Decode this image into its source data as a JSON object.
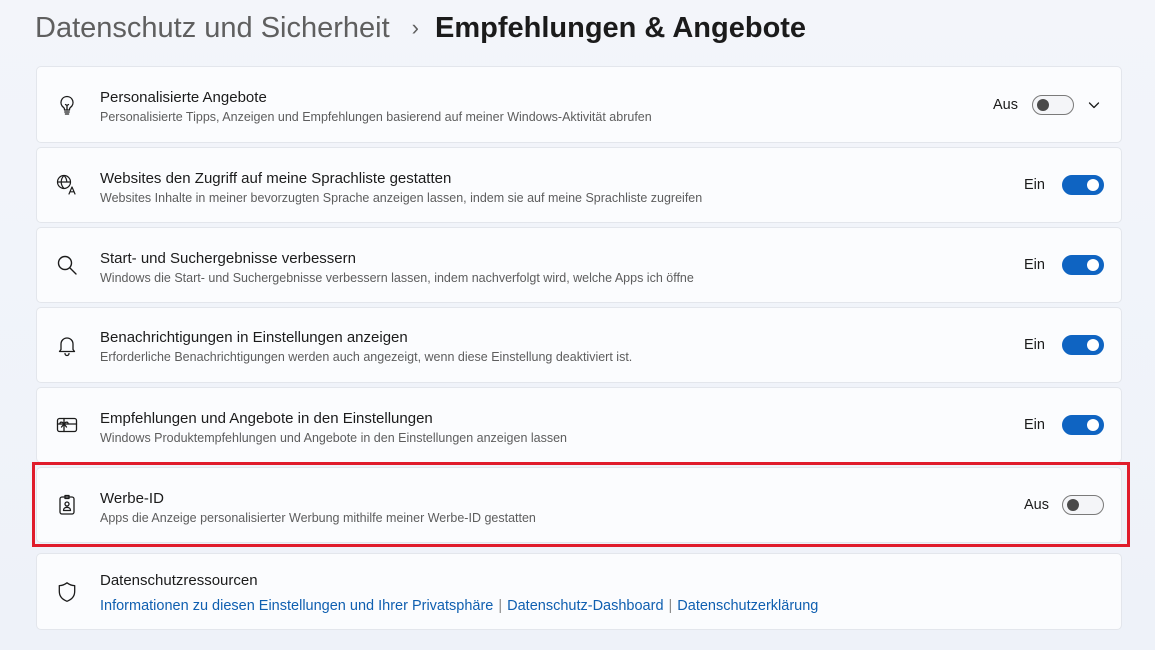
{
  "breadcrumb": {
    "parent": "Datenschutz und Sicherheit",
    "separator": "›",
    "current": "Empfehlungen & Angebote"
  },
  "settings": [
    {
      "title": "Personalisierte Angebote",
      "subtitle": "Personalisierte Tipps, Anzeigen und Empfehlungen basierend auf meiner Windows-Aktivität abrufen",
      "state_label": "Aus",
      "on": false,
      "icon": "lightbulb-icon",
      "expandable": true
    },
    {
      "title": "Websites den Zugriff auf meine Sprachliste gestatten",
      "subtitle": "Websites Inhalte in meiner bevorzugten Sprache anzeigen lassen, indem sie auf meine Sprachliste zugreifen",
      "state_label": "Ein",
      "on": true,
      "icon": "language-icon"
    },
    {
      "title": "Start- und Suchergebnisse verbessern",
      "subtitle": "Windows die Start- und Suchergebnisse verbessern lassen, indem nachverfolgt wird, welche Apps ich öffne",
      "state_label": "Ein",
      "on": true,
      "icon": "search-icon"
    },
    {
      "title": "Benachrichtigungen in Einstellungen anzeigen",
      "subtitle": "Erforderliche Benachrichtigungen werden auch angezeigt, wenn diese Einstellung deaktiviert ist.",
      "state_label": "Ein",
      "on": true,
      "icon": "bell-icon"
    },
    {
      "title": "Empfehlungen und Angebote in den Einstellungen",
      "subtitle": "Windows Produktempfehlungen und Angebote in den Einstellungen anzeigen lassen",
      "state_label": "Ein",
      "on": true,
      "icon": "gift-card-icon"
    },
    {
      "title": "Werbe-ID",
      "subtitle": "Apps die Anzeige personalisierter Werbung mithilfe meiner Werbe-ID gestatten",
      "state_label": "Aus",
      "on": false,
      "icon": "id-badge-icon"
    }
  ],
  "resources": {
    "title": "Datenschutzressourcen",
    "links": [
      "Informationen zu diesen Einstellungen und Ihrer Privatsphäre",
      "Datenschutz-Dashboard",
      "Datenschutzerklärung"
    ],
    "separator": "|",
    "icon": "shield-icon"
  },
  "colors": {
    "accent": "#0f64c2",
    "highlight": "#e01c2b",
    "link": "#0f5fb0"
  }
}
